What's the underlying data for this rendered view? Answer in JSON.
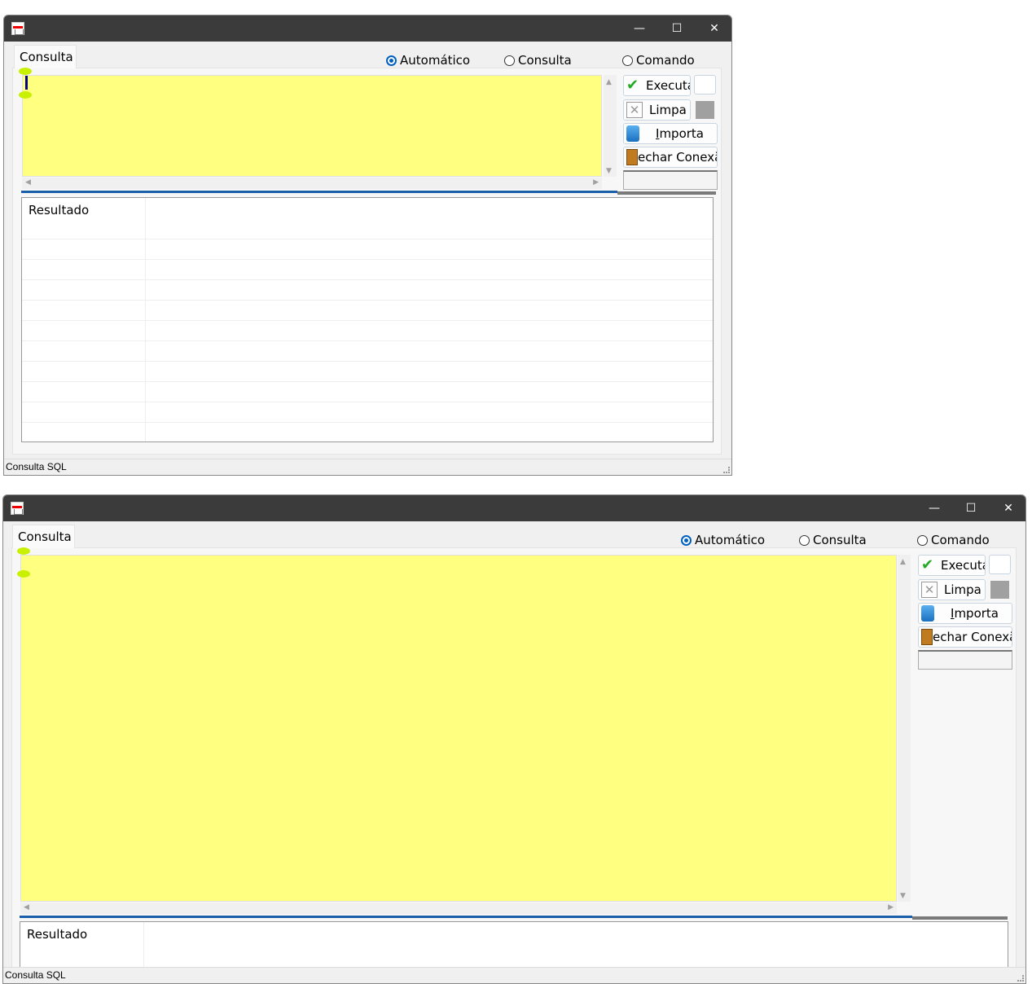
{
  "windows": [
    {
      "tab": "Consulta",
      "radios": [
        {
          "label": "Automático",
          "selected": true
        },
        {
          "label": "Consulta",
          "selected": false
        },
        {
          "label": "Comando",
          "selected": false
        }
      ],
      "buttons": {
        "executa": "Executa",
        "limpa": "Limpa",
        "importa_u": "I",
        "importa_rest": "mporta",
        "fechar": "echar Conexã"
      },
      "result_header": "Resultado",
      "status": "Consulta SQL",
      "window_controls": {
        "minimize": "—",
        "maximize": "☐",
        "close": "✕"
      }
    },
    {
      "tab": "Consulta",
      "radios": [
        {
          "label": "Automático",
          "selected": true
        },
        {
          "label": "Consulta",
          "selected": false
        },
        {
          "label": "Comando",
          "selected": false
        }
      ],
      "buttons": {
        "executa": "Executa",
        "limpa": "Limpa",
        "importa_u": "I",
        "importa_rest": "mporta",
        "fechar": "echar Conexã"
      },
      "result_header": "Resultado",
      "status": "Consulta SQL",
      "window_controls": {
        "minimize": "—",
        "maximize": "☐",
        "close": "✕"
      }
    }
  ]
}
